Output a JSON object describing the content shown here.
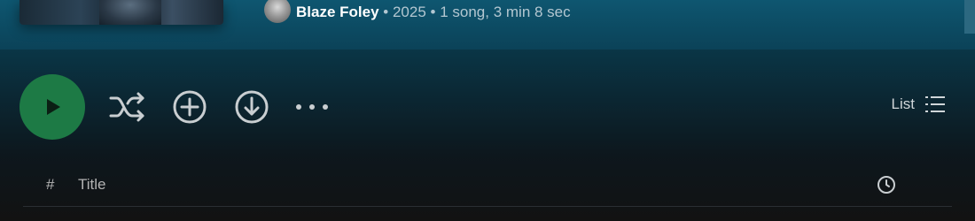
{
  "album_header": {
    "artist": "Blaze Foley",
    "separator": "•",
    "year": "2025",
    "summary": "1 song, 3 min 8 sec"
  },
  "actions": {
    "play_icon": "play-icon",
    "shuffle_icon": "shuffle-icon",
    "add_icon": "add-circle-icon",
    "download_icon": "download-icon",
    "more_icon": "more-icon",
    "view_label": "List",
    "view_icon": "list-icon"
  },
  "tracklist": {
    "columns": {
      "number": "#",
      "title": "Title",
      "duration_icon": "clock-icon"
    }
  },
  "colors": {
    "play_button": "#1d7a45",
    "header_gradient_top": "#0e5670",
    "background_bottom": "#121212"
  }
}
